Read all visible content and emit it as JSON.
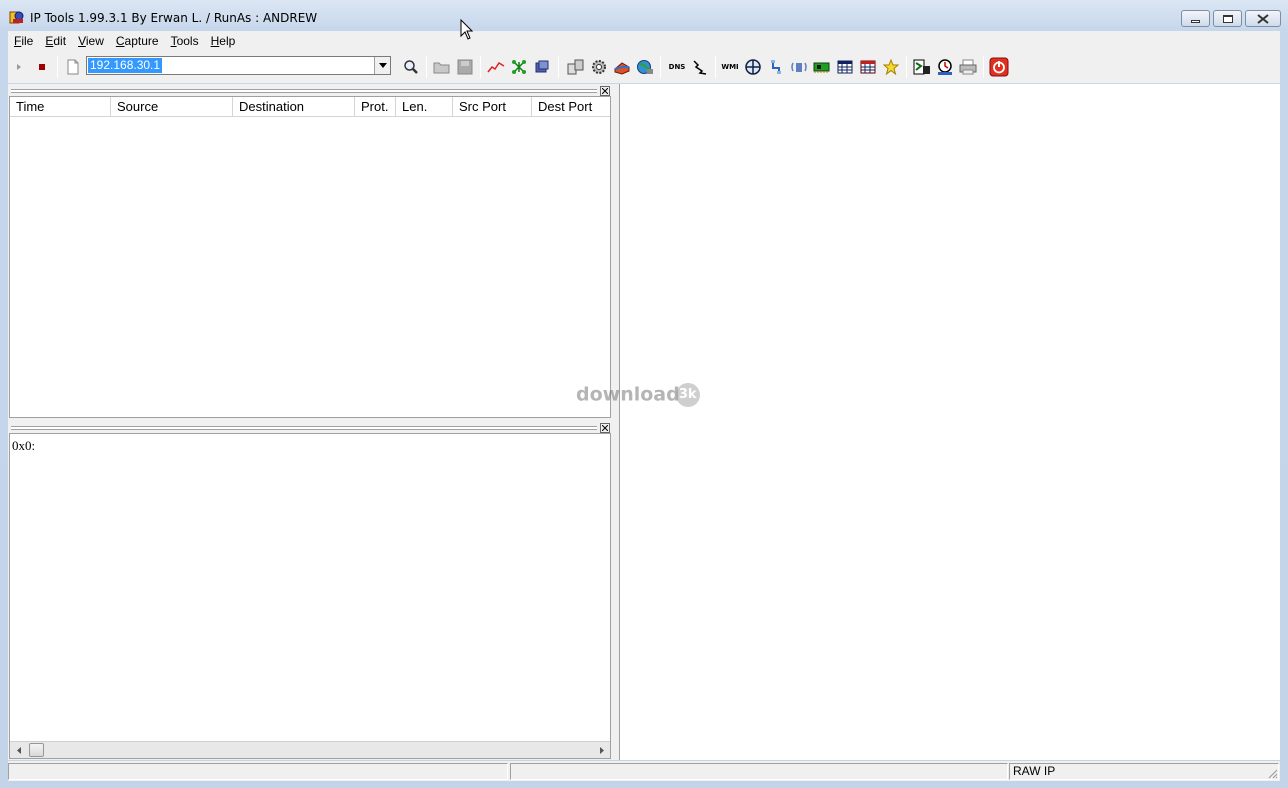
{
  "window": {
    "title": "IP Tools 1.99.3.1 By Erwan L. / RunAs : ANDREW"
  },
  "menu": [
    {
      "label": "File",
      "mnemonic": "F",
      "rest": "ile"
    },
    {
      "label": "Edit",
      "mnemonic": "E",
      "rest": "dit"
    },
    {
      "label": "View",
      "mnemonic": "V",
      "rest": "iew"
    },
    {
      "label": "Capture",
      "mnemonic": "C",
      "rest": "apture"
    },
    {
      "label": "Tools",
      "mnemonic": "T",
      "rest": "ools"
    },
    {
      "label": "Help",
      "mnemonic": "H",
      "rest": "elp"
    }
  ],
  "toolbar": {
    "address_value": "192.168.30.1",
    "icons": [
      "play-icon",
      "stop-icon",
      "new-file-icon",
      "search-icon",
      "open-folder-icon",
      "save-icon",
      "graph-icon",
      "network-map-icon",
      "switch-icon",
      "computers-icon",
      "settings-gear-icon",
      "ping-icon",
      "globe-icon",
      "dns-icon",
      "trace-icon",
      "wmi-icon",
      "crosshair-icon",
      "connection-icon",
      "wireless-icon",
      "network-card-icon",
      "table-icon",
      "ports-table-icon",
      "star-icon",
      "wake-icon",
      "scan-icon",
      "printer-icon",
      "power-icon"
    ],
    "dns_label": "DNS",
    "wmi_label": "WMI"
  },
  "packet_list": {
    "columns": [
      "Time",
      "Source",
      "Destination",
      "Prot.",
      "Len.",
      "Src Port",
      "Dest Port"
    ],
    "rows": []
  },
  "hex_view": {
    "text": "0x0:"
  },
  "watermark": {
    "text": "download",
    "badge": "3k"
  },
  "statusbar": {
    "panel1": "",
    "panel2": "",
    "panel3": "RAW IP"
  },
  "colors": {
    "selection": "#3399ff",
    "window_frame": "#c3d3e8",
    "stop_red": "#a00000",
    "power_red": "#e03020"
  }
}
